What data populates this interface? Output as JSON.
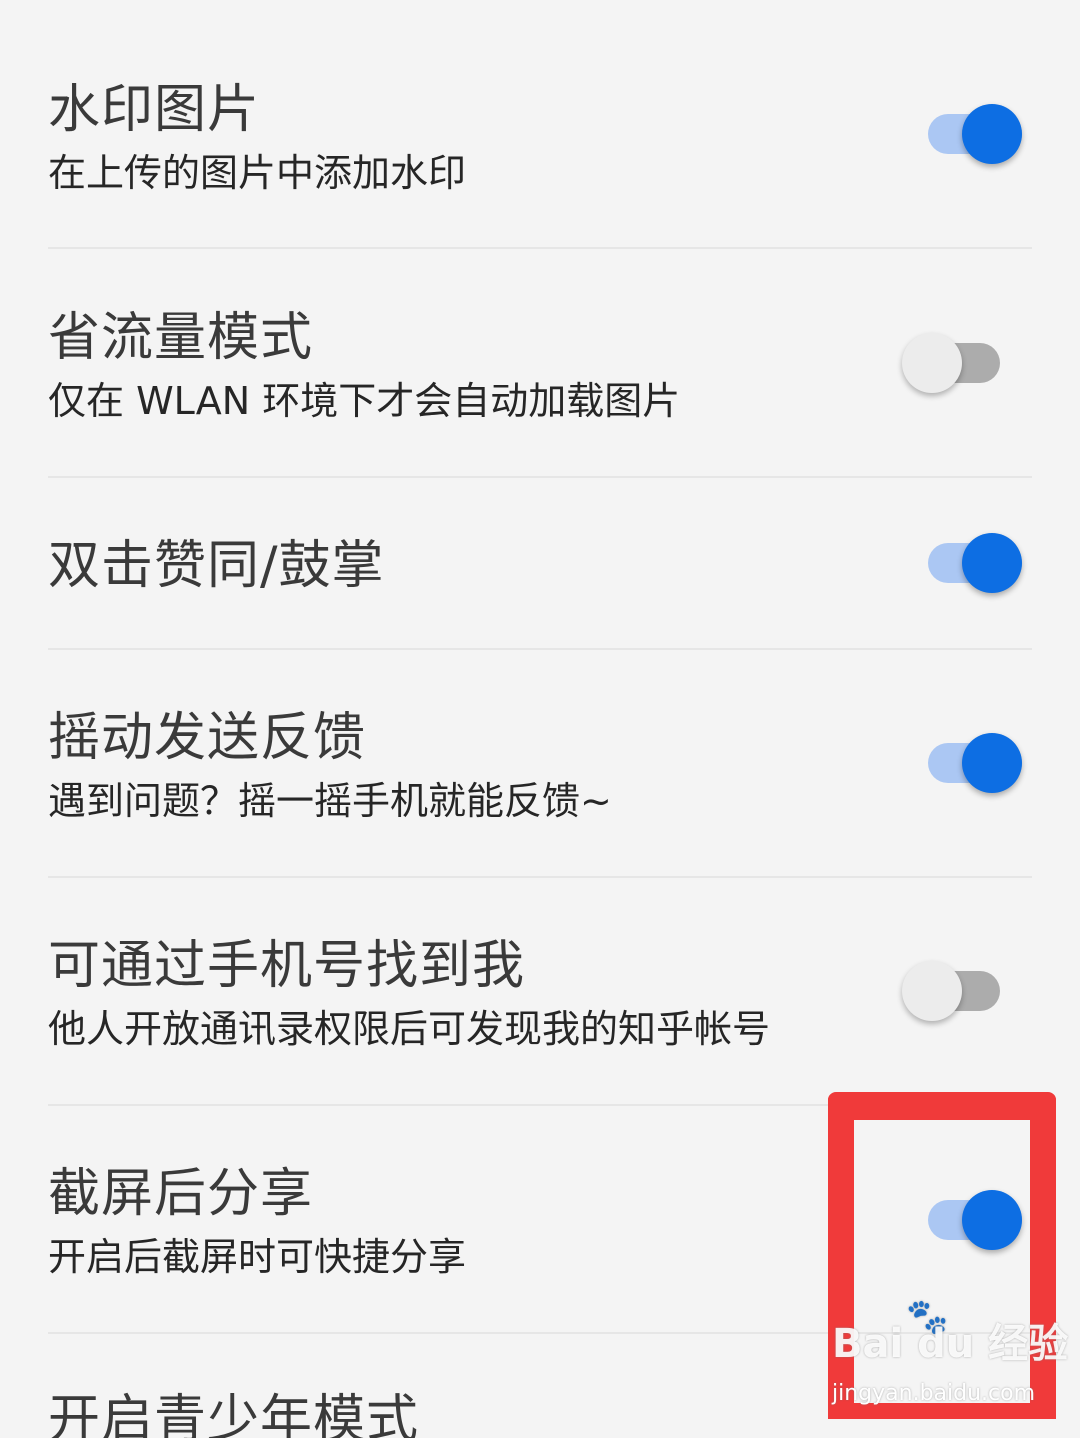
{
  "settings": [
    {
      "title": "水印图片",
      "subtitle": "在上传的图片中添加水印",
      "enabled": true
    },
    {
      "title": "省流量模式",
      "subtitle": "仅在 WLAN 环境下才会自动加载图片",
      "enabled": false
    },
    {
      "title": "双击赞同/鼓掌",
      "subtitle": "",
      "enabled": true
    },
    {
      "title": "摇动发送反馈",
      "subtitle": "遇到问题？摇一摇手机就能反馈~",
      "enabled": true
    },
    {
      "title": "可通过手机号找到我",
      "subtitle": "他人开放通讯录权限后可发现我的知乎帐号",
      "enabled": false
    },
    {
      "title": "截屏后分享",
      "subtitle": "开启后截屏时可快捷分享",
      "enabled": true
    },
    {
      "title": "开启青少年模式",
      "subtitle": ""
    }
  ],
  "colors": {
    "switch_on_thumb": "#0d6ee3",
    "switch_on_track": "#abc7f3",
    "switch_off_thumb": "#ececec",
    "switch_off_track": "#acacac",
    "annotation": "#f03a3a"
  },
  "watermark": {
    "logo": "Bai du 经验",
    "url": "jingyan.baidu.com"
  }
}
